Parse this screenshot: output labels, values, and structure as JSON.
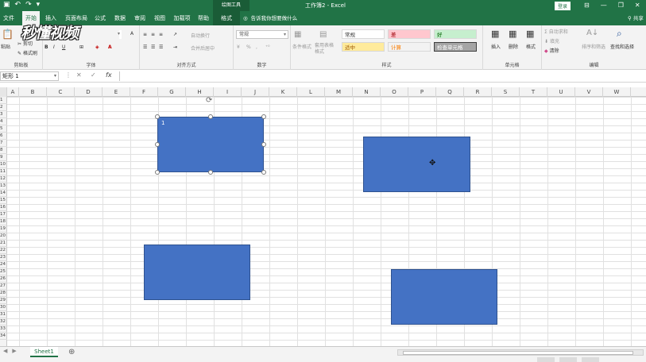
{
  "titlebar": {
    "context_tool": "绘图工具",
    "doc_title": "工作簿2  -  Excel",
    "login": "登录",
    "minimize": "—",
    "restore": "❐",
    "close": "✕"
  },
  "tabs": [
    {
      "label": "文件"
    },
    {
      "label": "开始"
    },
    {
      "label": "插入"
    },
    {
      "label": "页面布局"
    },
    {
      "label": "公式"
    },
    {
      "label": "数据"
    },
    {
      "label": "审阅"
    },
    {
      "label": "视图"
    },
    {
      "label": "加载项"
    },
    {
      "label": "帮助"
    },
    {
      "label": "格式"
    }
  ],
  "tell_me": "告诉我你想要做什么",
  "share": "共享",
  "ribbon": {
    "clipboard": {
      "label": "剪贴板",
      "paste": "粘贴",
      "cut": "剪切",
      "copy": "复制",
      "painter": "格式刷"
    },
    "font": {
      "label": "字体",
      "bold": "B",
      "italic": "I",
      "underline": "U",
      "font_color": "A"
    },
    "alignment": {
      "label": "对齐方式",
      "wrap": "自动换行",
      "merge": "合并后居中"
    },
    "number": {
      "label": "数字",
      "format": "常规",
      "percent": "%",
      "comma": ","
    },
    "styles": {
      "label": "样式",
      "conditional": "条件格式",
      "table": "套用表格格式",
      "cells": [
        {
          "name": "常规"
        },
        {
          "name": "差"
        },
        {
          "name": "好"
        },
        {
          "name": "适中"
        },
        {
          "name": "计算"
        },
        {
          "name": "检查单元格"
        }
      ]
    },
    "cells_group": {
      "label": "单元格",
      "insert": "插入",
      "delete": "删除",
      "format": "格式"
    },
    "editing": {
      "label": "编辑",
      "autosum": "自动求和",
      "fill": "填充",
      "clear": "清除",
      "sort": "排序和筛选",
      "find": "查找和选择"
    }
  },
  "logo_text": "秒懂视频",
  "formula_bar": {
    "name_box": "矩形 1",
    "cancel": "✕",
    "enter": "✓",
    "fx": "fx",
    "value": ""
  },
  "columns": [
    "A",
    "B",
    "C",
    "D",
    "E",
    "F",
    "G",
    "H",
    "I",
    "J",
    "K",
    "L",
    "M",
    "N",
    "O",
    "P",
    "Q",
    "R",
    "S",
    "T",
    "U",
    "V",
    "W"
  ],
  "rows": [
    "1",
    "2",
    "3",
    "4",
    "5",
    "6",
    "7",
    "8",
    "9",
    "10",
    "11",
    "12",
    "13",
    "14",
    "15",
    "16",
    "17",
    "18",
    "19",
    "20",
    "21",
    "22",
    "23",
    "24",
    "25",
    "26",
    "27",
    "28",
    "29",
    "30",
    "31",
    "32",
    "33",
    "34"
  ],
  "shapes": [
    {
      "name": "rectangle-1",
      "label": "1",
      "selected": true,
      "fill": "#4472c4"
    },
    {
      "name": "rectangle-2",
      "label": "",
      "selected": false,
      "fill": "#4472c4"
    },
    {
      "name": "rectangle-3",
      "label": "",
      "selected": false,
      "fill": "#4472c4"
    },
    {
      "name": "rectangle-4",
      "label": "",
      "selected": false,
      "fill": "#4472c4"
    }
  ],
  "sheets": [
    {
      "name": "Sheet1",
      "active": true
    }
  ],
  "colors": {
    "accent": "#217346",
    "shape_fill": "#4472c4",
    "shape_border": "#2f528f"
  }
}
